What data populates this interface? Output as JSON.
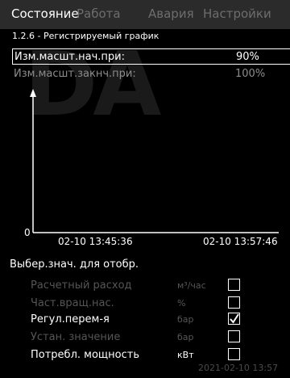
{
  "tabs": [
    {
      "label": "Состояние"
    },
    {
      "label": "Работа"
    },
    {
      "label": "Авария"
    },
    {
      "label": "Настройки"
    }
  ],
  "breadcrumb": "1.2.6 - Регистрируемый график",
  "params": [
    {
      "label": "Изм.масшт.нач.при:",
      "value": "90%"
    },
    {
      "label": "Изм.масшт.закнч.при:",
      "value": "100%"
    }
  ],
  "chart_data": {
    "type": "line",
    "title": "",
    "x": [
      "02-10 13:45:36",
      "02-10 13:57:46"
    ],
    "y_start_label": "0",
    "series": []
  },
  "section_title": "Выбер.знач. для отобр.",
  "options": [
    {
      "label": "Расчетный расход",
      "unit": "м³/час",
      "checked": false,
      "enabled": false
    },
    {
      "label": "Част.вращ.нас.",
      "unit": "%",
      "checked": false,
      "enabled": false
    },
    {
      "label": "Регул.перем-я",
      "unit": "бар",
      "checked": true,
      "enabled": true
    },
    {
      "label": "Устан. значение",
      "unit": "бар",
      "checked": false,
      "enabled": false
    },
    {
      "label": "Потребл. мощность",
      "unit": "кВт",
      "checked": false,
      "enabled": true
    }
  ],
  "timestamp": "2021-02-10 13:57",
  "colors": {
    "background": "#000000",
    "tab_bar": "#2b2b2b",
    "text": "#ffffff",
    "muted": "#555555"
  }
}
